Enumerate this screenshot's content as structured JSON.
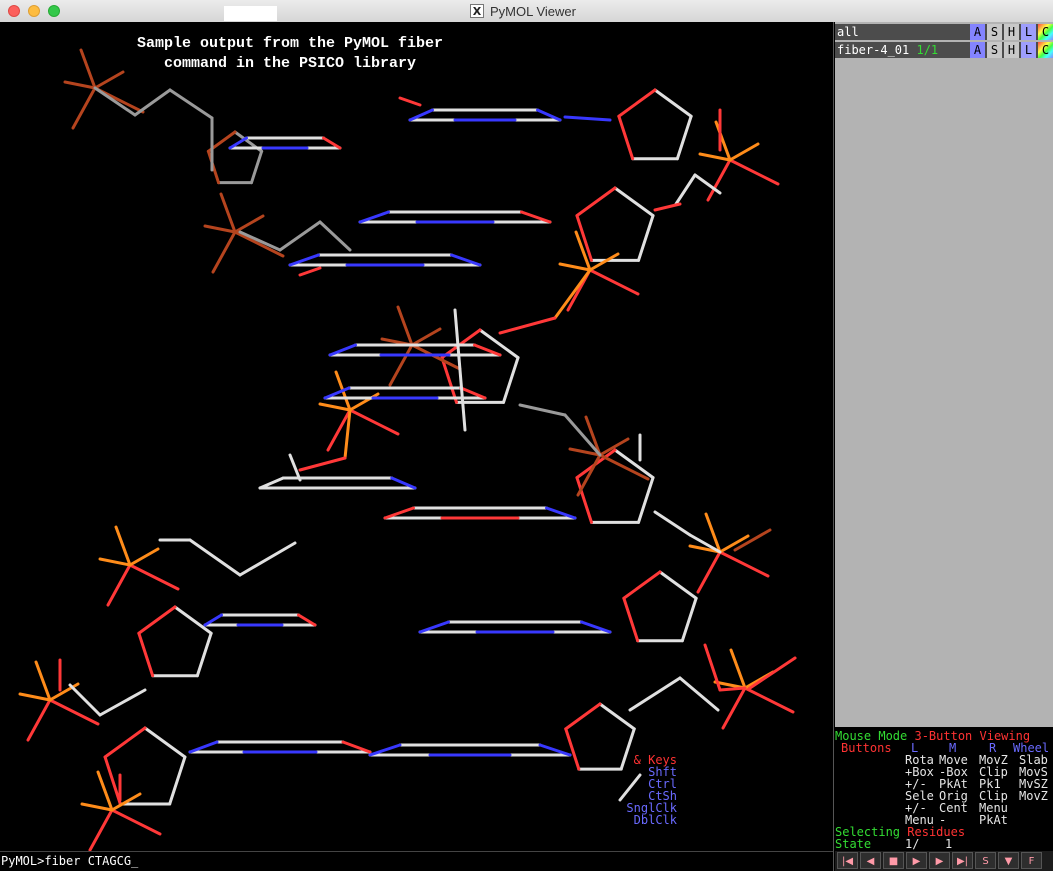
{
  "window": {
    "title": "PyMOL Viewer",
    "x11_icon": "X"
  },
  "viewport": {
    "caption": "Sample output from the PyMOL fiber\ncommand in the PSICO library",
    "background": "#000000"
  },
  "command_line": {
    "prompt": "PyMOL>",
    "text": "fiber CTAGCG_"
  },
  "objects": [
    {
      "name": "all",
      "state": "",
      "buttons": [
        "A",
        "S",
        "H",
        "L",
        "C"
      ]
    },
    {
      "name": "fiber-4_01",
      "state": "1/1",
      "buttons": [
        "A",
        "S",
        "H",
        "L",
        "C"
      ]
    }
  ],
  "mouse_panel": {
    "mode_line": [
      "Mouse Mode",
      "3-Button Viewing"
    ],
    "header": [
      "Buttons",
      "L",
      "M",
      "R",
      "Wheel"
    ],
    "rows": [
      [
        "& Keys",
        "Rota",
        "Move",
        "MovZ",
        "Slab"
      ],
      [
        "Shft",
        "+Box",
        "-Box",
        "Clip",
        "MovS"
      ],
      [
        "Ctrl",
        "+/-",
        "PkAt",
        "Pk1",
        "MvSZ"
      ],
      [
        "CtSh",
        "Sele",
        "Orig",
        "Clip",
        "MovZ"
      ],
      [
        "SnglClk",
        "+/-",
        "Cent",
        "Menu",
        ""
      ],
      [
        "DblClk",
        "Menu",
        "-",
        "PkAt",
        ""
      ]
    ],
    "selecting": [
      "Selecting",
      "Residues"
    ],
    "state": {
      "label": "State",
      "current": "1/",
      "total": "1"
    }
  },
  "vcr_buttons": [
    "|◀",
    "◀",
    "■",
    "▶",
    "▶",
    "▶|",
    "S",
    "▼",
    "F"
  ],
  "colors": {
    "carbon": "#e0e0e0",
    "carbon_dim": "#9a9a9a",
    "nitrogen": "#3838ff",
    "oxygen": "#ff3838",
    "phosphorus": "#ff8c1a",
    "panel_green": "#33dd33",
    "panel_red": "#ff3333",
    "panel_blue": "#6a6aff"
  }
}
